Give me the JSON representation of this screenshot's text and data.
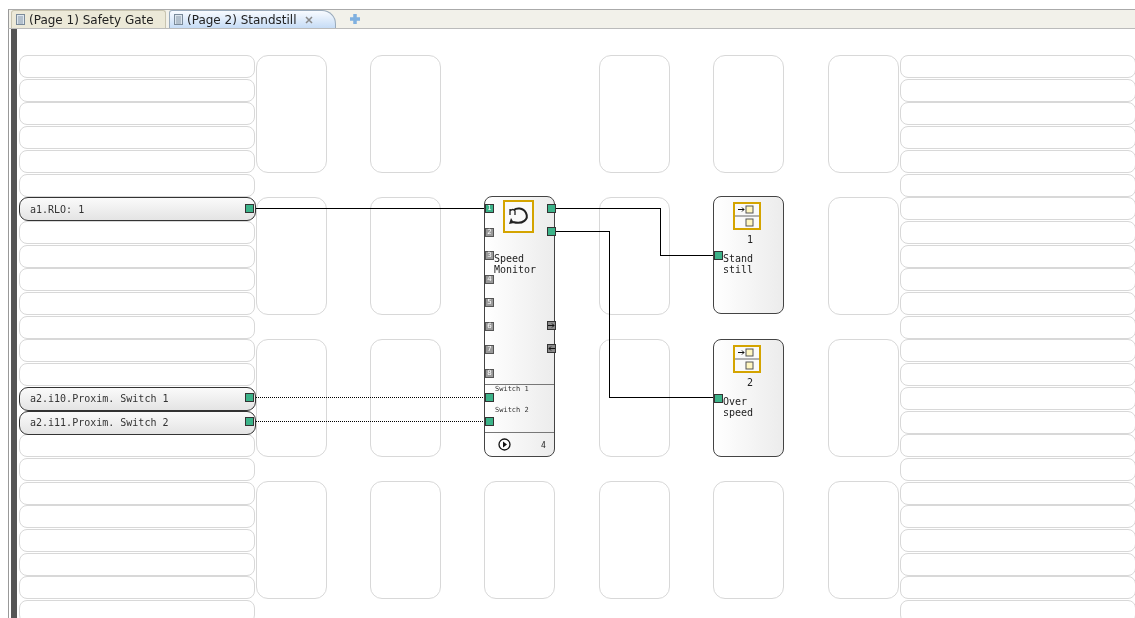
{
  "tabs": [
    {
      "label": "(Page 1) Safety Gate",
      "selected": false,
      "closable": false
    },
    {
      "label": "(Page 2) Standstill",
      "selected": true,
      "closable": true
    }
  ],
  "inputs": [
    {
      "label": "a1.RLO: 1",
      "dashed": false
    },
    {
      "label": "a2.i10.Proxim. Switch 1",
      "dashed": true
    },
    {
      "label": "a2.i11.Proxim. Switch 2",
      "dashed": true
    }
  ],
  "function_block": {
    "title": "Speed Monitor",
    "number": "4",
    "ports": [
      {
        "label": "1",
        "connected": true
      },
      {
        "label": "2",
        "connected": false
      },
      {
        "label": "3",
        "connected": false
      },
      {
        "label": "4",
        "connected": false
      },
      {
        "label": "5",
        "connected": false
      },
      {
        "label": "6",
        "connected": false
      },
      {
        "label": "7",
        "connected": false
      },
      {
        "label": "8",
        "connected": false
      }
    ],
    "switches": [
      {
        "label": "Switch 1",
        "connected": true
      },
      {
        "label": "Switch 2",
        "connected": true
      }
    ],
    "outputs": [
      {
        "connected": true
      },
      {
        "connected": true
      },
      {
        "connected": false
      },
      {
        "connected": false
      }
    ]
  },
  "outputs": [
    {
      "number": "1",
      "label": "Stand still"
    },
    {
      "number": "2",
      "label": "Over speed"
    }
  ]
}
